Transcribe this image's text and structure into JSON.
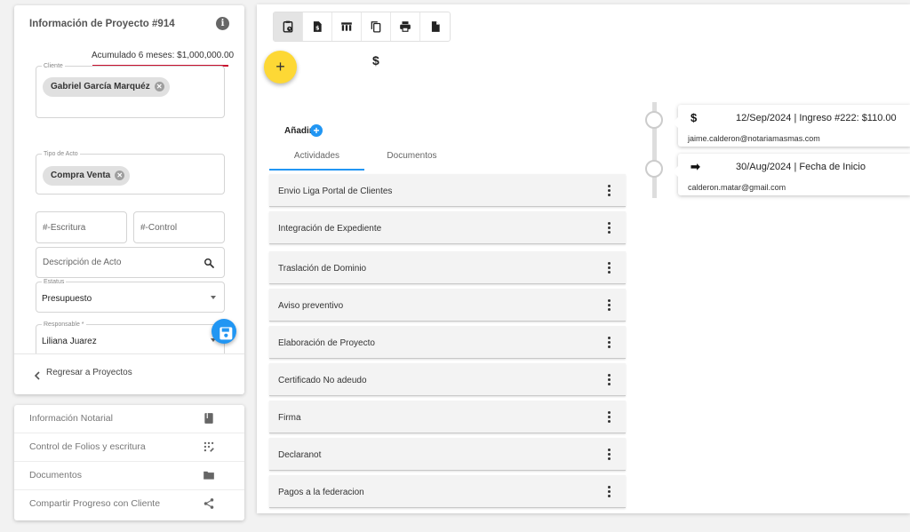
{
  "project": {
    "title": "Información de Proyecto #914",
    "info_icon": "info-icon",
    "accumulated": "Acumulado 6 meses: $1,000,000.00",
    "cliente": {
      "legend": "Cliente",
      "chip": "Gabriel García Marquéz"
    },
    "tipo_acto": {
      "legend": "Tipo de Acto",
      "chip": "Compra Venta"
    },
    "escritura_placeholder": "#-Escritura",
    "control_placeholder": "#-Control",
    "descripcion_placeholder": "Descripción de Acto",
    "estatus": {
      "legend": "Estatus",
      "value": "Presupuesto"
    },
    "responsable": {
      "legend": "Responsable *",
      "value": "Liliana Juarez"
    },
    "back_label": "Regresar a Proyectos"
  },
  "menu": {
    "items": [
      {
        "label": "Información Notarial",
        "icon": "book-icon"
      },
      {
        "label": "Control de Folios y escritura",
        "icon": "dial-pad-icon"
      },
      {
        "label": "Documentos",
        "icon": "folder-icon"
      },
      {
        "label": "Compartir Progreso con Cliente",
        "icon": "share-icon"
      }
    ]
  },
  "toolbar": {
    "buttons": [
      "clipboard-clock-icon",
      "document-dollar-icon",
      "table-icon",
      "copy-icon",
      "print-icon",
      "file-icon"
    ]
  },
  "header": {
    "dollar": "$"
  },
  "activities": {
    "add_label": "Añadir",
    "add_symbol": "+",
    "tabs": [
      "Actividades",
      "Documentos"
    ],
    "items": [
      "Envio Liga Portal de Clientes",
      "Integración de Expediente",
      "Traslación de Dominio",
      "Aviso preventivo",
      "Elaboración de Proyecto",
      "Certificado No adeudo",
      "Firma",
      "Declaranot",
      "Pagos a la federacion"
    ]
  },
  "timeline": [
    {
      "icon": "$",
      "title": "12/Sep/2024 | Ingreso #222: $110.00",
      "email": "jaime.calderon@notariamasmas.com"
    },
    {
      "icon": "➡",
      "title": "30/Aug/2024 | Fecha de Inicio",
      "email": "calderon.matar@gmail.com"
    }
  ],
  "colors": {
    "accent_blue": "#2196f3",
    "fab_yellow": "#fdd835",
    "underline_red": "#c8102e"
  }
}
